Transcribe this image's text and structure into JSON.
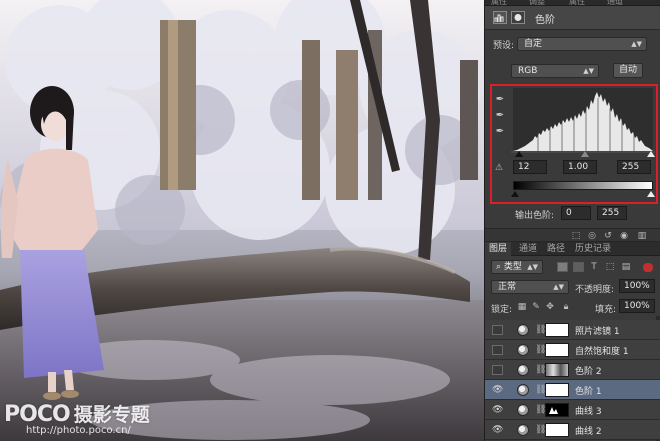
{
  "panel": {
    "top_tabs": [
      "属性",
      "调整",
      "属性",
      "通道"
    ],
    "properties_title": "色阶",
    "preset_label": "预设:",
    "preset_value": "自定",
    "channel_value": "RGB",
    "auto_button": "自动",
    "input_black": "12",
    "input_gamma": "1.00",
    "input_white": "255",
    "output_label": "输出色阶:",
    "output_black": "0",
    "output_white": "255"
  },
  "layers": {
    "tabs": [
      "图层",
      "通道",
      "路径",
      "历史记录"
    ],
    "filter_kind": "类型",
    "blend_mode": "正常",
    "opacity_label": "不透明度:",
    "opacity_value": "100%",
    "lock_label": "锁定:",
    "fill_label": "填充:",
    "fill_value": "100%",
    "items": [
      {
        "name": "照片滤镜 1",
        "visible": false,
        "selected": false,
        "mask": "white"
      },
      {
        "name": "自然饱和度 1",
        "visible": false,
        "selected": false,
        "mask": "white"
      },
      {
        "name": "色阶 2",
        "visible": false,
        "selected": false,
        "mask": "photo"
      },
      {
        "name": "色阶 1",
        "visible": true,
        "selected": true,
        "mask": "white"
      },
      {
        "name": "曲线 3",
        "visible": true,
        "selected": false,
        "mask": "black"
      },
      {
        "name": "曲线 2",
        "visible": true,
        "selected": false,
        "mask": "white"
      }
    ]
  },
  "watermark": {
    "brand": "POCO",
    "brand_zh": "摄影专题",
    "url": "http://photo.poco.cn/"
  },
  "colors": {
    "panel_bg": "#3a3a3a",
    "selected_row": "#5b6a80",
    "highlight_box": "#d9202a"
  }
}
